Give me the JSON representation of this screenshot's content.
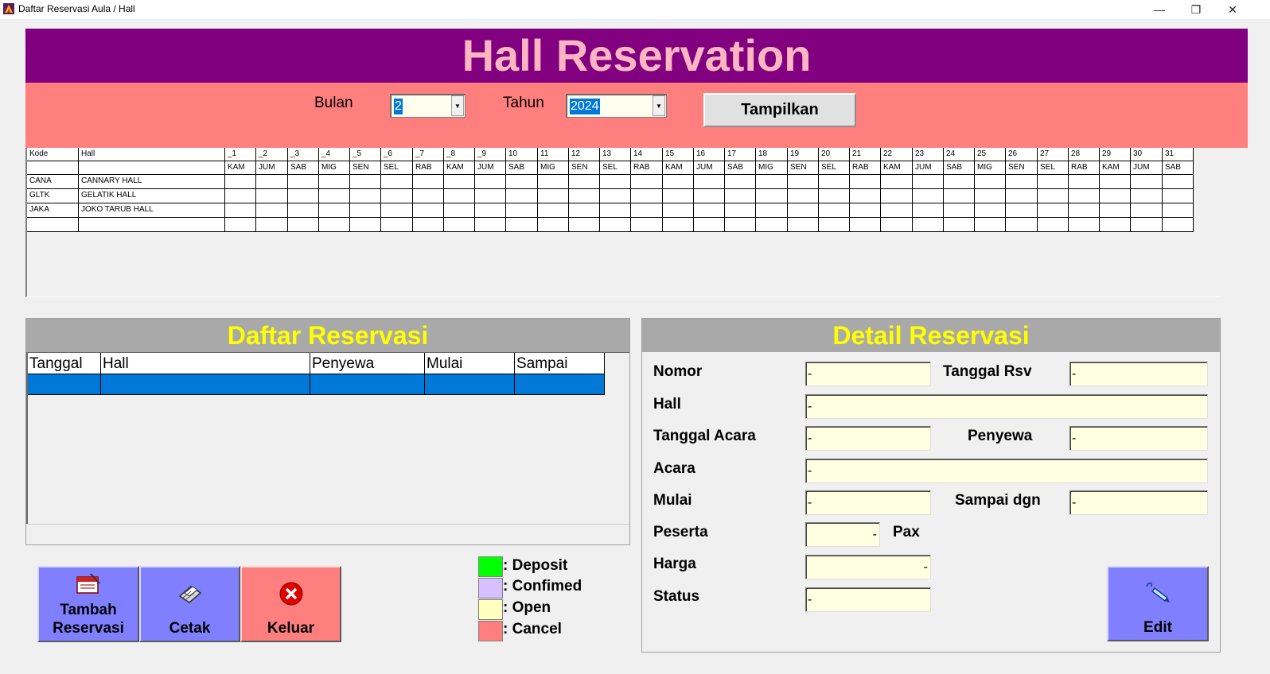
{
  "window": {
    "title": "Daftar Reservasi Aula / Hall",
    "minimize_glyph": "—",
    "maximize_glyph": "❐",
    "close_glyph": "✕"
  },
  "header": {
    "title": "Hall Reservation"
  },
  "filter": {
    "bulan_label": "Bulan",
    "bulan_value": "2",
    "tahun_label": "Tahun",
    "tahun_value": "2024",
    "show_button": "Tampilkan",
    "dropdown_arrow": "▼"
  },
  "calendar": {
    "kode_header": "Kode",
    "hall_header": "Hall",
    "day_numbers": [
      "_1",
      "_2",
      "_3",
      "_4",
      "_5",
      "_6",
      "_7",
      "_8",
      "_9",
      "10",
      "11",
      "12",
      "13",
      "14",
      "15",
      "16",
      "17",
      "18",
      "19",
      "20",
      "21",
      "22",
      "23",
      "24",
      "25",
      "26",
      "27",
      "28",
      "29",
      "30",
      "31"
    ],
    "day_names": [
      "KAM",
      "JUM",
      "SAB",
      "MIG",
      "SEN",
      "SEL",
      "RAB",
      "KAM",
      "JUM",
      "SAB",
      "MIG",
      "SEN",
      "SEL",
      "RAB",
      "KAM",
      "JUM",
      "SAB",
      "MIG",
      "SEN",
      "SEL",
      "RAB",
      "KAM",
      "JUM",
      "SAB",
      "MIG",
      "SEN",
      "SEL",
      "RAB",
      "KAM",
      "JUM",
      "SAB"
    ],
    "rows": [
      {
        "kode": "CANA",
        "hall": "CANNARY HALL"
      },
      {
        "kode": "GLTK",
        "hall": "GELATIK HALL"
      },
      {
        "kode": "JAKA",
        "hall": "JOKO TARUB HALL"
      },
      {
        "kode": "",
        "hall": ""
      }
    ]
  },
  "daftar": {
    "title": "Daftar Reservasi",
    "columns": [
      "Tanggal",
      "Hall",
      "Penyewa",
      "Mulai",
      "Sampai"
    ]
  },
  "detail": {
    "title": "Detail Reservasi",
    "nomor_label": "Nomor",
    "nomor_value": "-",
    "tanggal_rsv_label": "Tanggal Rsv",
    "tanggal_rsv_value": "-",
    "hall_label": "Hall",
    "hall_value": "-",
    "tanggal_acara_label": "Tanggal Acara",
    "tanggal_acara_value": "-",
    "penyewa_label": "Penyewa",
    "penyewa_value": "-",
    "acara_label": "Acara",
    "acara_value": "-",
    "mulai_label": "Mulai",
    "mulai_value": "-",
    "sampai_label": "Sampai dgn",
    "sampai_value": "-",
    "peserta_label": "Peserta",
    "peserta_value": "-",
    "pax_label": "Pax",
    "harga_label": "Harga",
    "harga_value": "-",
    "status_label": "Status",
    "status_value": "-"
  },
  "buttons": {
    "tambah_line1": "Tambah",
    "tambah_line2": "Reservasi",
    "cetak": "Cetak",
    "keluar": "Keluar",
    "edit": "Edit"
  },
  "legend": [
    {
      "label": ": Deposit",
      "color": "#00ff00"
    },
    {
      "label": ": Confimed",
      "color": "#d8bfff"
    },
    {
      "label": ": Open",
      "color": "#ffffc0"
    },
    {
      "label": ": Cancel",
      "color": "#ff7f7f"
    }
  ],
  "colors": {
    "header_bg": "#800080",
    "header_text": "#ffb6c1",
    "filter_bg": "#ff7f7f",
    "section_title": "#ffff00",
    "selection": "#0078d7",
    "button_blue": "#7f7fff",
    "button_red": "#ff7f7f",
    "field_bg": "#ffffe1"
  }
}
